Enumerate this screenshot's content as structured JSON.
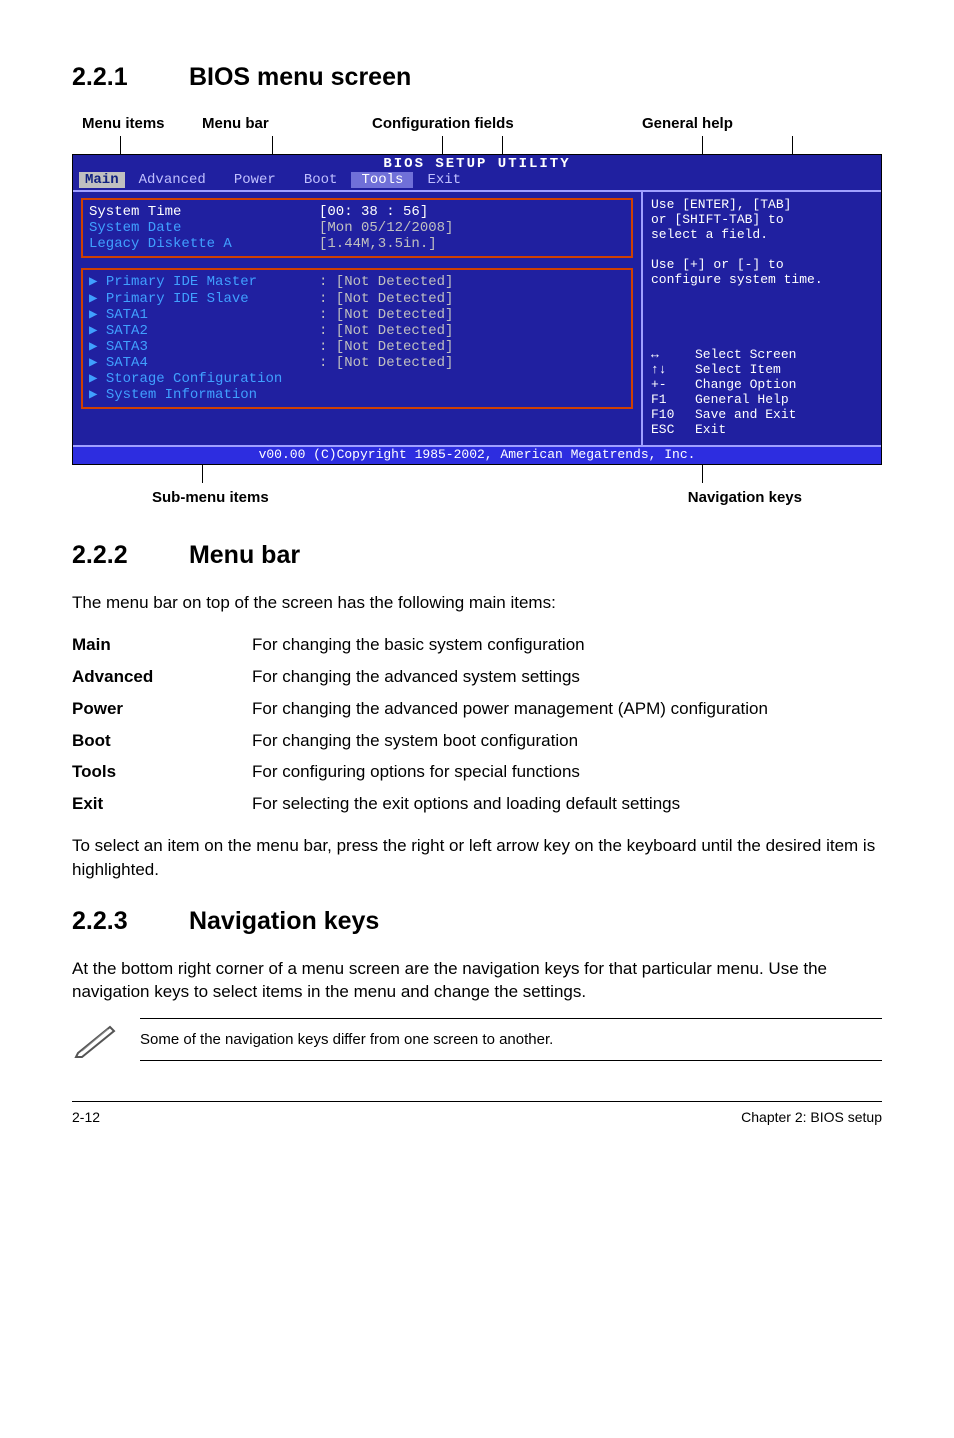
{
  "sections": {
    "s221": {
      "num": "2.2.1",
      "title": "BIOS menu screen"
    },
    "s222": {
      "num": "2.2.2",
      "title": "Menu bar"
    },
    "s223": {
      "num": "2.2.3",
      "title": "Navigation keys"
    }
  },
  "diagram_labels": {
    "menu_items": "Menu items",
    "menu_bar": "Menu bar",
    "config_fields": "Configuration fields",
    "general_help": "General help",
    "sub_menu": "Sub-menu items",
    "nav_keys": "Navigation keys"
  },
  "bios": {
    "title": "BIOS SETUP UTILITY",
    "tabs": {
      "main": "Main",
      "advanced": "Advanced",
      "power": "Power",
      "boot": "Boot",
      "tools": "Tools",
      "exit": "Exit"
    },
    "group1": [
      {
        "k": "System Time",
        "v": "[00: 38 : 56]"
      },
      {
        "k": "System Date",
        "v": "[Mon 05/12/2008]"
      },
      {
        "k": "Legacy Diskette A",
        "v": "[1.44M,3.5in.]"
      }
    ],
    "group2": [
      {
        "k": "Primary IDE Master",
        "v": ": [Not Detected]",
        "tri": true
      },
      {
        "k": "Primary IDE Slave",
        "v": ": [Not Detected]",
        "tri": true
      },
      {
        "k": "SATA1",
        "v": ": [Not Detected]",
        "tri": true
      },
      {
        "k": "SATA2",
        "v": ": [Not Detected]",
        "tri": true
      },
      {
        "k": "SATA3",
        "v": ": [Not Detected]",
        "tri": true
      },
      {
        "k": "SATA4",
        "v": ": [Not Detected]",
        "tri": true
      },
      {
        "k": "",
        "v": ""
      },
      {
        "k": "Storage Configuration",
        "v": "",
        "tri": true
      },
      {
        "k": "System Information",
        "v": "",
        "tri": true
      }
    ],
    "help_top": [
      "Use [ENTER], [TAB]",
      "or [SHIFT-TAB] to",
      "select a field.",
      "",
      "Use [+] or [-] to",
      "configure system time."
    ],
    "help_keys": [
      {
        "k": "↔",
        "d": "Select Screen"
      },
      {
        "k": "↑↓",
        "d": "Select Item"
      },
      {
        "k": "+-",
        "d": "Change Option"
      },
      {
        "k": "F1",
        "d": "General Help"
      },
      {
        "k": "F10",
        "d": "Save and Exit"
      },
      {
        "k": "ESC",
        "d": "Exit"
      }
    ],
    "footer": "v00.00 (C)Copyright 1985-2002, American Megatrends, Inc."
  },
  "menubar_intro": "The menu bar on top of the screen has the following main items:",
  "menubar_items": [
    {
      "term": "Main",
      "desc": "For changing the basic system configuration"
    },
    {
      "term": "Advanced",
      "desc": "For changing the advanced system settings"
    },
    {
      "term": "Power",
      "desc": "For changing the advanced power management (APM) configuration"
    },
    {
      "term": "Boot",
      "desc": "For changing the system boot configuration"
    },
    {
      "term": "Tools",
      "desc": "For configuring options for special functions"
    },
    {
      "term": "Exit",
      "desc": "For selecting the exit options and loading default settings"
    }
  ],
  "menubar_outro": "To select an item on the menu bar, press the right or left arrow key on the keyboard until the desired item is highlighted.",
  "navkeys_para": "At the bottom right corner of a menu screen are the navigation keys for that particular menu. Use the navigation keys to select items in the menu and change the settings.",
  "note": "Some of the navigation keys differ from one screen to another.",
  "page_footer": {
    "left": "2-12",
    "right": "Chapter 2: BIOS setup"
  }
}
